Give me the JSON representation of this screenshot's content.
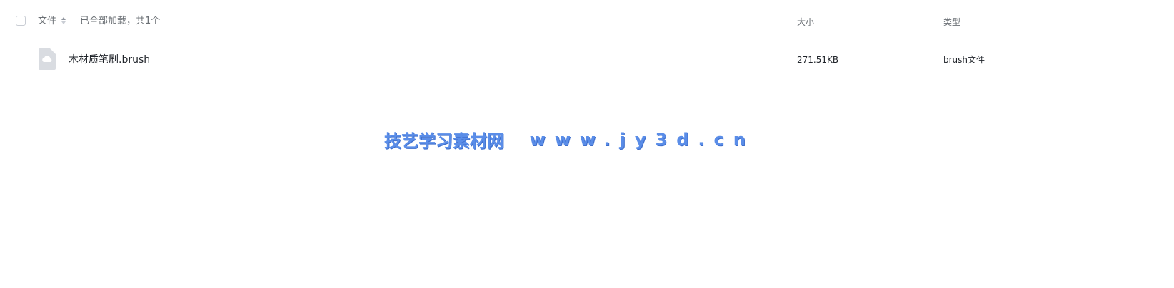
{
  "header": {
    "select_all": "",
    "name_label": "文件",
    "load_status": "已全部加载，共1个",
    "size_label": "大小",
    "type_label": "类型"
  },
  "files": [
    {
      "icon": "cloud-file-icon",
      "name": "木材质笔刷.brush",
      "size": "271.51KB",
      "type": "brush文件"
    }
  ],
  "watermark": {
    "cn": "技艺学习素材网",
    "url": "www.jy3d.cn"
  },
  "colors": {
    "watermark": "#5a8de8",
    "muted_text": "#6b7075",
    "primary_text": "#1f2329",
    "icon_bg": "#d9dce1"
  }
}
